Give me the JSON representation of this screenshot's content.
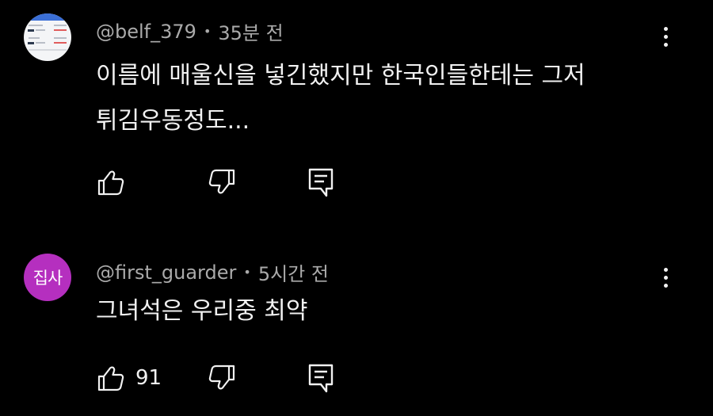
{
  "comments": [
    {
      "author": "@belf_379",
      "separator": "•",
      "time": "35분 전",
      "lines": [
        "이름에 매울신을 넣긴했지만 한국인들한테는 그저",
        "튀김우동정도..."
      ],
      "like_count": ""
    },
    {
      "author": "@first_guarder",
      "separator": "•",
      "time": "5시간 전",
      "avatar_text": "집사",
      "avatar_color": "#b52fbf",
      "lines": [
        "그녀석은 우리중 최약"
      ],
      "like_count": "91"
    }
  ],
  "icons": {
    "like": "thumbs-up-icon",
    "dislike": "thumbs-down-icon",
    "reply": "reply-comment-icon",
    "more": "more-vertical-icon"
  },
  "colors": {
    "background": "#000000",
    "text": "#f1f1f1",
    "meta": "#aaaaaa"
  }
}
